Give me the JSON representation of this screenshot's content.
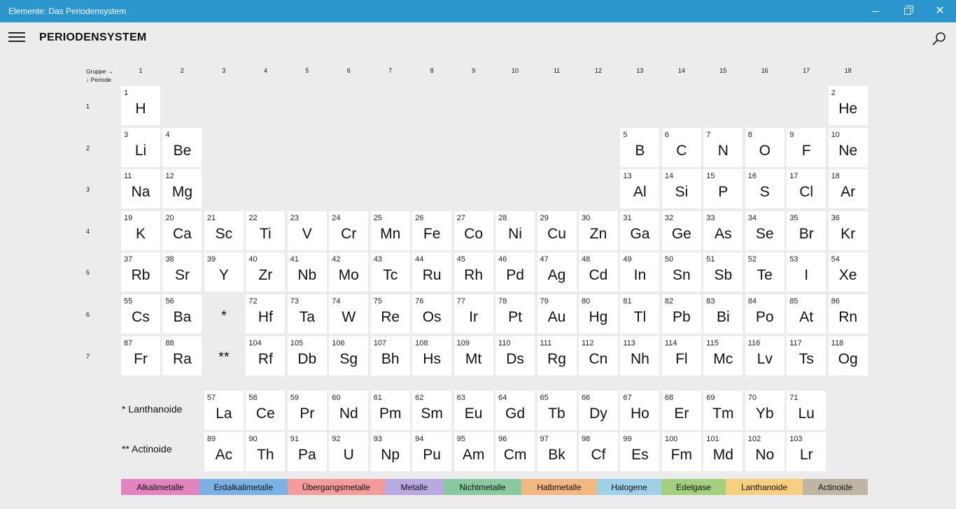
{
  "window": {
    "title": "Elemente: Das Periodensystem"
  },
  "appbar": {
    "title": "PERIODENSYSTEM"
  },
  "axes": {
    "group_header": "Gruppe →",
    "period_header": "↓ Periode",
    "groups": [
      "1",
      "2",
      "3",
      "4",
      "5",
      "6",
      "7",
      "8",
      "9",
      "10",
      "11",
      "12",
      "13",
      "14",
      "15",
      "16",
      "17",
      "18"
    ],
    "periods": [
      "1",
      "2",
      "3",
      "4",
      "5",
      "6",
      "7"
    ]
  },
  "placeholders": {
    "lanthanides": "*",
    "actinides": "**"
  },
  "series_labels": {
    "lanthanides": "* Lanthanoide",
    "actinides": "** Actinoide"
  },
  "elements": [
    {
      "n": "1",
      "s": "H"
    },
    {
      "n": "2",
      "s": "He"
    },
    {
      "n": "3",
      "s": "Li"
    },
    {
      "n": "4",
      "s": "Be"
    },
    {
      "n": "5",
      "s": "B"
    },
    {
      "n": "6",
      "s": "C"
    },
    {
      "n": "7",
      "s": "N"
    },
    {
      "n": "8",
      "s": "O"
    },
    {
      "n": "9",
      "s": "F"
    },
    {
      "n": "10",
      "s": "Ne"
    },
    {
      "n": "11",
      "s": "Na"
    },
    {
      "n": "12",
      "s": "Mg"
    },
    {
      "n": "13",
      "s": "Al"
    },
    {
      "n": "14",
      "s": "Si"
    },
    {
      "n": "15",
      "s": "P"
    },
    {
      "n": "16",
      "s": "S"
    },
    {
      "n": "17",
      "s": "Cl"
    },
    {
      "n": "18",
      "s": "Ar"
    },
    {
      "n": "19",
      "s": "K"
    },
    {
      "n": "20",
      "s": "Ca"
    },
    {
      "n": "21",
      "s": "Sc"
    },
    {
      "n": "22",
      "s": "Ti"
    },
    {
      "n": "23",
      "s": "V"
    },
    {
      "n": "24",
      "s": "Cr"
    },
    {
      "n": "25",
      "s": "Mn"
    },
    {
      "n": "26",
      "s": "Fe"
    },
    {
      "n": "27",
      "s": "Co"
    },
    {
      "n": "28",
      "s": "Ni"
    },
    {
      "n": "29",
      "s": "Cu"
    },
    {
      "n": "30",
      "s": "Zn"
    },
    {
      "n": "31",
      "s": "Ga"
    },
    {
      "n": "32",
      "s": "Ge"
    },
    {
      "n": "33",
      "s": "As"
    },
    {
      "n": "34",
      "s": "Se"
    },
    {
      "n": "35",
      "s": "Br"
    },
    {
      "n": "36",
      "s": "Kr"
    },
    {
      "n": "37",
      "s": "Rb"
    },
    {
      "n": "38",
      "s": "Sr"
    },
    {
      "n": "39",
      "s": "Y"
    },
    {
      "n": "40",
      "s": "Zr"
    },
    {
      "n": "41",
      "s": "Nb"
    },
    {
      "n": "42",
      "s": "Mo"
    },
    {
      "n": "43",
      "s": "Tc"
    },
    {
      "n": "44",
      "s": "Ru"
    },
    {
      "n": "45",
      "s": "Rh"
    },
    {
      "n": "46",
      "s": "Pd"
    },
    {
      "n": "47",
      "s": "Ag"
    },
    {
      "n": "48",
      "s": "Cd"
    },
    {
      "n": "49",
      "s": "In"
    },
    {
      "n": "50",
      "s": "Sn"
    },
    {
      "n": "51",
      "s": "Sb"
    },
    {
      "n": "52",
      "s": "Te"
    },
    {
      "n": "53",
      "s": "I"
    },
    {
      "n": "54",
      "s": "Xe"
    },
    {
      "n": "55",
      "s": "Cs"
    },
    {
      "n": "56",
      "s": "Ba"
    },
    {
      "n": "72",
      "s": "Hf"
    },
    {
      "n": "73",
      "s": "Ta"
    },
    {
      "n": "74",
      "s": "W"
    },
    {
      "n": "75",
      "s": "Re"
    },
    {
      "n": "76",
      "s": "Os"
    },
    {
      "n": "77",
      "s": "Ir"
    },
    {
      "n": "78",
      "s": "Pt"
    },
    {
      "n": "79",
      "s": "Au"
    },
    {
      "n": "80",
      "s": "Hg"
    },
    {
      "n": "81",
      "s": "Tl"
    },
    {
      "n": "82",
      "s": "Pb"
    },
    {
      "n": "83",
      "s": "Bi"
    },
    {
      "n": "84",
      "s": "Po"
    },
    {
      "n": "85",
      "s": "At"
    },
    {
      "n": "86",
      "s": "Rn"
    },
    {
      "n": "87",
      "s": "Fr"
    },
    {
      "n": "88",
      "s": "Ra"
    },
    {
      "n": "104",
      "s": "Rf"
    },
    {
      "n": "105",
      "s": "Db"
    },
    {
      "n": "106",
      "s": "Sg"
    },
    {
      "n": "107",
      "s": "Bh"
    },
    {
      "n": "108",
      "s": "Hs"
    },
    {
      "n": "109",
      "s": "Mt"
    },
    {
      "n": "110",
      "s": "Ds"
    },
    {
      "n": "111",
      "s": "Rg"
    },
    {
      "n": "112",
      "s": "Cn"
    },
    {
      "n": "113",
      "s": "Nh"
    },
    {
      "n": "114",
      "s": "Fl"
    },
    {
      "n": "115",
      "s": "Mc"
    },
    {
      "n": "116",
      "s": "Lv"
    },
    {
      "n": "117",
      "s": "Ts"
    },
    {
      "n": "118",
      "s": "Og"
    },
    {
      "n": "57",
      "s": "La"
    },
    {
      "n": "58",
      "s": "Ce"
    },
    {
      "n": "59",
      "s": "Pr"
    },
    {
      "n": "60",
      "s": "Nd"
    },
    {
      "n": "61",
      "s": "Pm"
    },
    {
      "n": "62",
      "s": "Sm"
    },
    {
      "n": "63",
      "s": "Eu"
    },
    {
      "n": "64",
      "s": "Gd"
    },
    {
      "n": "65",
      "s": "Tb"
    },
    {
      "n": "66",
      "s": "Dy"
    },
    {
      "n": "67",
      "s": "Ho"
    },
    {
      "n": "68",
      "s": "Er"
    },
    {
      "n": "69",
      "s": "Tm"
    },
    {
      "n": "70",
      "s": "Yb"
    },
    {
      "n": "71",
      "s": "Lu"
    },
    {
      "n": "89",
      "s": "Ac"
    },
    {
      "n": "90",
      "s": "Th"
    },
    {
      "n": "91",
      "s": "Pa"
    },
    {
      "n": "92",
      "s": "U"
    },
    {
      "n": "93",
      "s": "Np"
    },
    {
      "n": "94",
      "s": "Pu"
    },
    {
      "n": "95",
      "s": "Am"
    },
    {
      "n": "96",
      "s": "Cm"
    },
    {
      "n": "97",
      "s": "Bk"
    },
    {
      "n": "98",
      "s": "Cf"
    },
    {
      "n": "99",
      "s": "Es"
    },
    {
      "n": "100",
      "s": "Fm"
    },
    {
      "n": "101",
      "s": "Md"
    },
    {
      "n": "102",
      "s": "No"
    },
    {
      "n": "103",
      "s": "Lr"
    }
  ],
  "legend": [
    {
      "label": "Alkalimetalle",
      "color": "#e384c1"
    },
    {
      "label": "Erdalkalimetalle",
      "color": "#7cb2e3"
    },
    {
      "label": "Übergangsmetalle",
      "color": "#f39c9a"
    },
    {
      "label": "Metalle",
      "color": "#b8a9e0"
    },
    {
      "label": "Nichtmetalle",
      "color": "#88c9a0"
    },
    {
      "label": "Halbmetalle",
      "color": "#f3b882"
    },
    {
      "label": "Halogene",
      "color": "#9fd0ea"
    },
    {
      "label": "Edelgase",
      "color": "#a4cf7c"
    },
    {
      "label": "Lanthanoide",
      "color": "#f7cf7e"
    },
    {
      "label": "Actinoide",
      "color": "#bfb5a4"
    }
  ]
}
